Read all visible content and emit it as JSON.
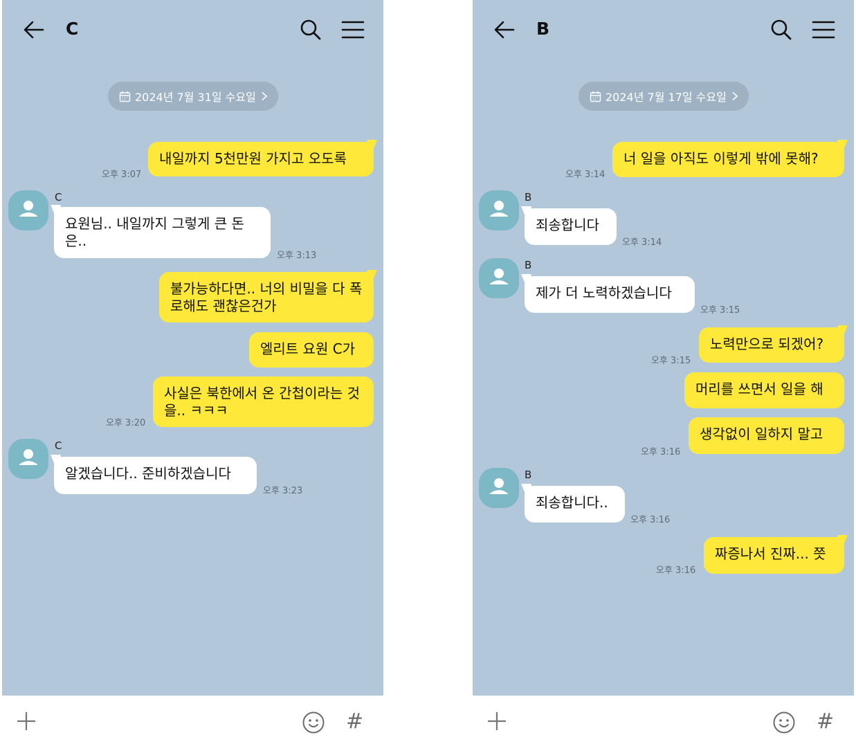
{
  "colors": {
    "chat_bg": "#b2c7da",
    "my_bubble": "#fee93a",
    "their_bubble": "#ffffff",
    "avatar": "#7cb8c5"
  },
  "left": {
    "title": "C",
    "date": "2024년 7월 31일 수요일",
    "messages": [
      {
        "sender": "",
        "text": "내일까지 5천만원 가지고 오도록",
        "time": "오후 3:07"
      },
      {
        "sender": "C",
        "text": "요원님.. 내일까지 그렇게 큰 돈은..",
        "time": "오후 3:13"
      },
      {
        "sender": "",
        "text": "불가능하다면.. 너의 비밀을 다 폭로해도 괜찮은건가",
        "time": ""
      },
      {
        "sender": "",
        "text": "엘리트 요원 C가",
        "time": ""
      },
      {
        "sender": "",
        "text": "사실은 북한에서 온 간첩이라는 것을.. ㅋㅋㅋ",
        "time": "오후 3:20"
      },
      {
        "sender": "C",
        "text": "알겠습니다.. 준비하겠습니다",
        "time": "오후 3:23"
      }
    ]
  },
  "right": {
    "title": "B",
    "date": "2024년 7월 17일 수요일",
    "messages": [
      {
        "sender": "",
        "text": "너 일을 아직도 이렇게 밖에 못해?",
        "time": "오후 3:14"
      },
      {
        "sender": "B",
        "text": "죄송합니다",
        "time": "오후 3:14"
      },
      {
        "sender": "B",
        "text": "제가 더 노력하겠습니다",
        "time": "오후 3:15"
      },
      {
        "sender": "",
        "text": "노력만으로 되겠어?",
        "time": "오후 3:15"
      },
      {
        "sender": "",
        "text": "머리를 쓰면서 일을 해",
        "time": ""
      },
      {
        "sender": "",
        "text": "생각없이 일하지 말고",
        "time": "오후 3:16"
      },
      {
        "sender": "B",
        "text": "죄송합니다..",
        "time": "오후 3:16"
      },
      {
        "sender": "",
        "text": "짜증나서 진짜... 쯧",
        "time": "오후 3:16"
      }
    ]
  },
  "input": {
    "hash": "#"
  }
}
